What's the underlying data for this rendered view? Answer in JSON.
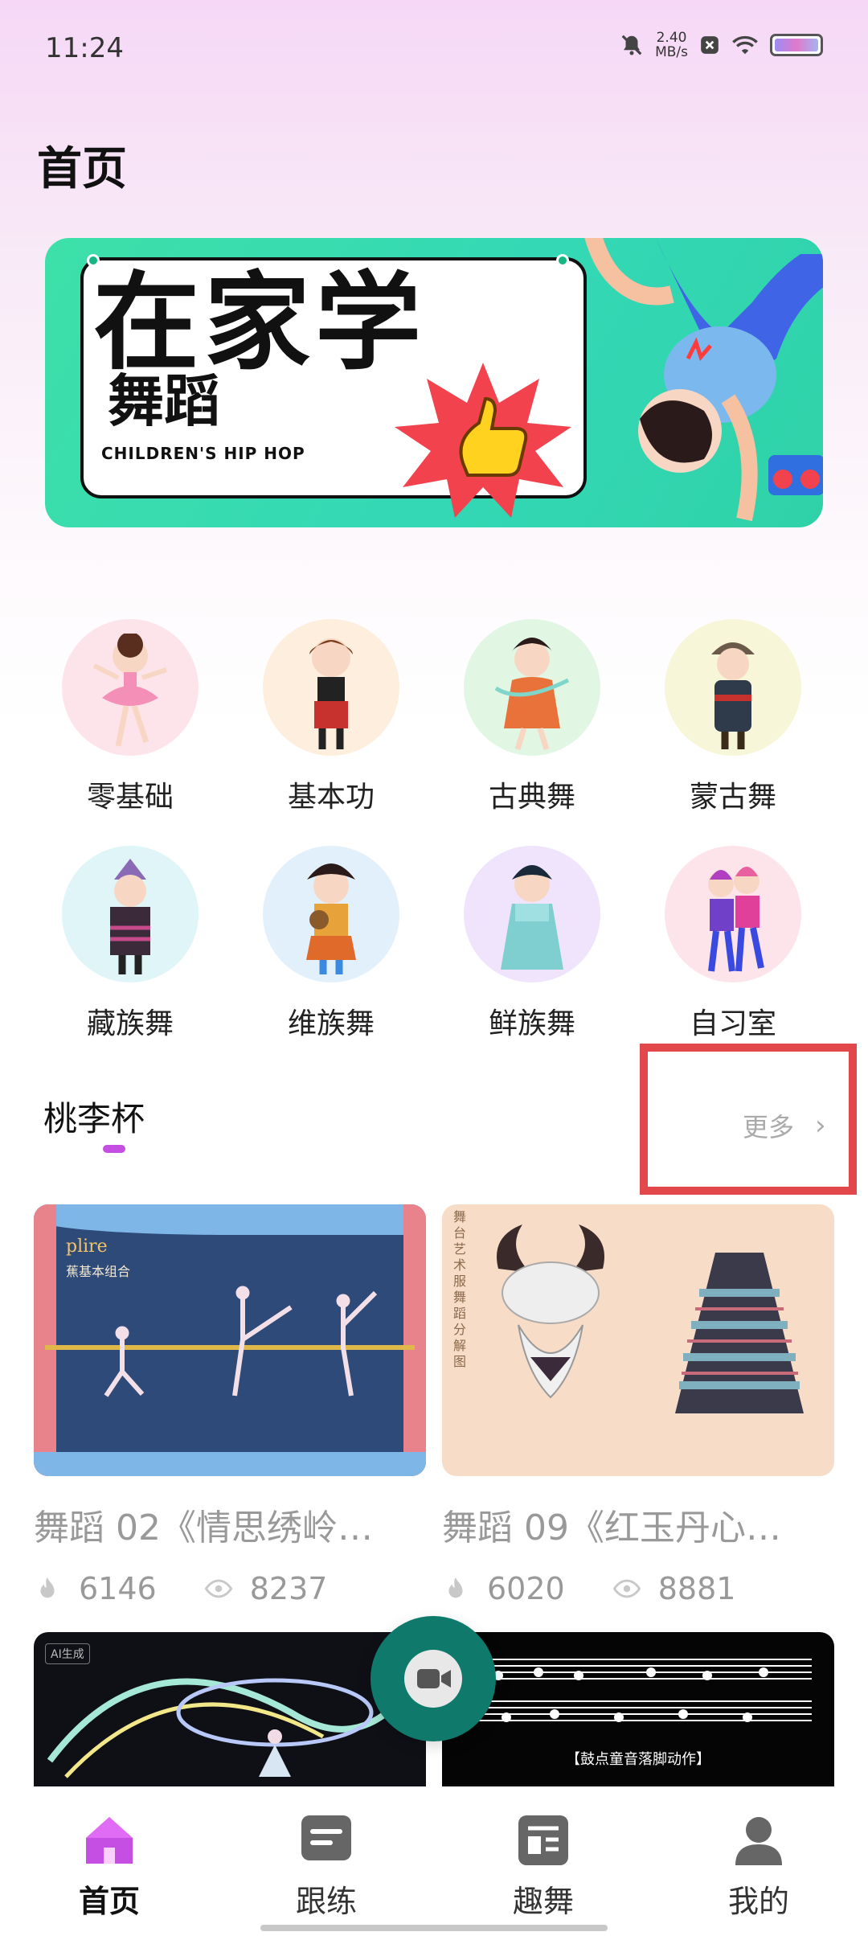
{
  "status_bar": {
    "time": "11:24",
    "net_speed_value": "2.40",
    "net_speed_unit": "MB/s",
    "icons": [
      "mute-bell-icon",
      "close-box-icon",
      "wifi-icon",
      "battery-icon"
    ]
  },
  "header": {
    "title": "首页"
  },
  "banner": {
    "main_text": "在家学",
    "sub_text": "舞蹈",
    "english_text": "CHILDREN'S HIP HOP"
  },
  "categories": [
    {
      "label": "零基础",
      "bg": "#fde4ea"
    },
    {
      "label": "基本功",
      "bg": "#fdeede"
    },
    {
      "label": "古典舞",
      "bg": "#e2f6e4"
    },
    {
      "label": "蒙古舞",
      "bg": "#f8f6d8"
    },
    {
      "label": "藏族舞",
      "bg": "#e0f5f7"
    },
    {
      "label": "维族舞",
      "bg": "#e2f0fb"
    },
    {
      "label": "鲜族舞",
      "bg": "#efe4fb"
    },
    {
      "label": "自习室",
      "bg": "#fde4ea"
    }
  ],
  "section": {
    "title": "桃李杯",
    "more_label": "更多",
    "chevron": "›"
  },
  "cards": [
    {
      "title": "舞蹈 02《情思绣岭…",
      "likes": "6146",
      "views": "8237",
      "thumb_text": "plire",
      "thumb_sub": "蕉基本组合"
    },
    {
      "title": "舞蹈 09《红玉丹心…",
      "likes": "6020",
      "views": "8881",
      "thumb_text": "舞台艺术服舞蹈分解图",
      "thumb_sub": ""
    },
    {
      "title": "",
      "likes": "",
      "views": "",
      "thumb_text": "AI生成",
      "thumb_sub": ""
    },
    {
      "title": "",
      "likes": "",
      "views": "",
      "thumb_text": "【鼓点童音落脚动作】",
      "thumb_sub": ""
    }
  ],
  "bottom_nav": [
    {
      "label": "首页",
      "active": true,
      "icon": "home-icon"
    },
    {
      "label": "跟练",
      "active": false,
      "icon": "practice-icon"
    },
    {
      "label": "趣舞",
      "active": false,
      "icon": "fun-dance-icon"
    },
    {
      "label": "我的",
      "active": false,
      "icon": "profile-icon"
    }
  ],
  "colors": {
    "accent": "#c54fe3",
    "fab": "#0f7a6c",
    "highlight": "#e2474b",
    "banner": "#3de0a8"
  }
}
